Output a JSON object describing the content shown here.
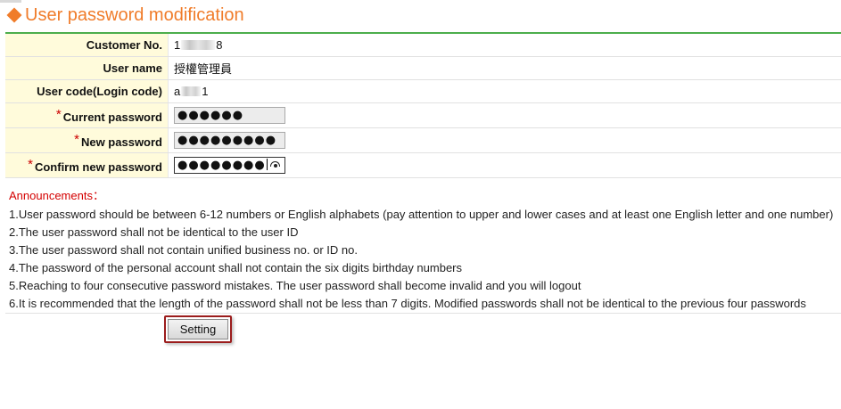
{
  "page": {
    "title": "User password modification"
  },
  "form": {
    "customer_no": {
      "label": "Customer No.",
      "value_prefix": "1",
      "value_suffix": "8"
    },
    "user_name": {
      "label": "User name",
      "value": "授權管理員"
    },
    "user_code": {
      "label": "User code(Login code)",
      "value_prefix": "a",
      "value_suffix": "1"
    },
    "current_password": {
      "required_mark": "*",
      "label": "Current password",
      "masked_value": "●●●●●●"
    },
    "new_password": {
      "required_mark": "*",
      "label": "New password",
      "masked_value": "●●●●●●●●●"
    },
    "confirm_password": {
      "required_mark": "*",
      "label": "Confirm new password",
      "masked_value": "●●●●●●●●"
    }
  },
  "announcements": {
    "title": "Announcements：",
    "items": [
      "1.User password should be between 6-12 numbers or English alphabets (pay attention to upper and lower cases and at least one English letter and one number)",
      "2.The user password shall not be identical to the user ID",
      "3.The user password shall not contain unified business no. or ID no.",
      "4.The password of the personal account shall not contain the six digits birthday numbers",
      "5.Reaching to four consecutive password mistakes. The user password shall become invalid and you will logout",
      "6.It is recommended that the length of the password shall not be less than 7 digits. Modified passwords shall not be identical to the previous four passwords"
    ]
  },
  "actions": {
    "setting_label": "Setting"
  },
  "colors": {
    "title_accent": "#f07c2a",
    "table_top_border": "#4cae4c",
    "label_background": "#fffbdb",
    "announcement_title": "#d40000",
    "focus_outline": "#9b1c1c"
  },
  "icons": {
    "title_marker": "orange-diamond",
    "password_reveal": "eye-icon"
  }
}
